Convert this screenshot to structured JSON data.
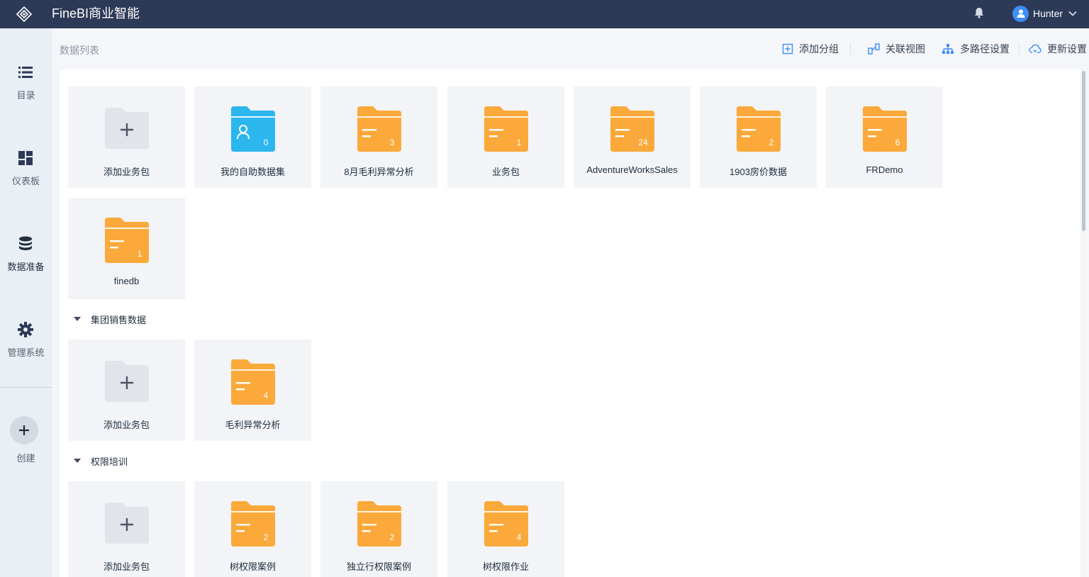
{
  "app": {
    "title": "FineBI商业智能",
    "logo_icon": "finebi-logo-icon"
  },
  "header": {
    "username": "Hunter",
    "bell_icon": "bell-icon"
  },
  "sidebar": {
    "items": [
      {
        "label": "目录",
        "icon": "list-icon"
      },
      {
        "label": "仪表板",
        "icon": "dashboard-icon"
      },
      {
        "label": "数据准备",
        "icon": "database-icon",
        "active": true
      },
      {
        "label": "管理系统",
        "icon": "gear-icon"
      }
    ],
    "create_label": "创建"
  },
  "page": {
    "breadcrumb": "数据列表"
  },
  "toolbar": {
    "add_group": "添加分组",
    "relation_view": "关联视图",
    "multipath": "多路径设置",
    "update": "更新设置"
  },
  "colors": {
    "folder": "#fba93a",
    "self_folder": "#2bb6ed",
    "topbar": "#2c3a57"
  },
  "main": {
    "add_label": "添加业务包",
    "top_packages": [
      {
        "name": "我的自助数据集",
        "count": "0",
        "type": "self"
      },
      {
        "name": "8月毛利异常分析",
        "count": "3"
      },
      {
        "name": "业务包",
        "count": "1"
      },
      {
        "name": "AdventureWorksSales",
        "count": "24"
      },
      {
        "name": "1903房价数据",
        "count": "2"
      },
      {
        "name": "FRDemo",
        "count": "6"
      },
      {
        "name": "finedb",
        "count": "1"
      }
    ],
    "groups": [
      {
        "name": "集团销售数据",
        "packages": [
          {
            "name": "毛利异常分析",
            "count": "4"
          }
        ]
      },
      {
        "name": "权限培训",
        "packages": [
          {
            "name": "树权限案例",
            "count": "2"
          },
          {
            "name": "独立行权限案例",
            "count": "2"
          },
          {
            "name": "树权限作业",
            "count": "4"
          }
        ]
      }
    ]
  }
}
